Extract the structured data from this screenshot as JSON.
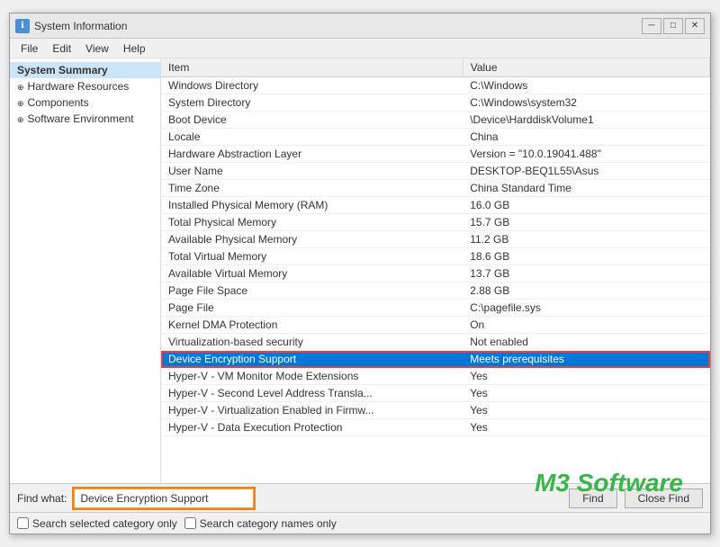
{
  "window": {
    "title": "System Information",
    "icon": "ℹ"
  },
  "menu": {
    "items": [
      "File",
      "Edit",
      "View",
      "Help"
    ]
  },
  "sidebar": {
    "items": [
      {
        "label": "System Summary",
        "level": 0,
        "bold": true,
        "selected": true,
        "expand": ""
      },
      {
        "label": "Hardware Resources",
        "level": 0,
        "bold": false,
        "selected": false,
        "expand": "⊕"
      },
      {
        "label": "Components",
        "level": 0,
        "bold": false,
        "selected": false,
        "expand": "⊕"
      },
      {
        "label": "Software Environment",
        "level": 0,
        "bold": false,
        "selected": false,
        "expand": "⊕"
      }
    ]
  },
  "table": {
    "headers": [
      "Item",
      "Value"
    ],
    "rows": [
      {
        "item": "Windows Directory",
        "value": "C:\\Windows",
        "highlighted": false
      },
      {
        "item": "System Directory",
        "value": "C:\\Windows\\system32",
        "highlighted": false
      },
      {
        "item": "Boot Device",
        "value": "\\Device\\HarddiskVolume1",
        "highlighted": false
      },
      {
        "item": "Locale",
        "value": "China",
        "highlighted": false
      },
      {
        "item": "Hardware Abstraction Layer",
        "value": "Version = \"10.0.19041.488\"",
        "highlighted": false
      },
      {
        "item": "User Name",
        "value": "DESKTOP-BEQ1L55\\Asus",
        "highlighted": false
      },
      {
        "item": "Time Zone",
        "value": "China Standard Time",
        "highlighted": false
      },
      {
        "item": "Installed Physical Memory (RAM)",
        "value": "16.0 GB",
        "highlighted": false
      },
      {
        "item": "Total Physical Memory",
        "value": "15.7 GB",
        "highlighted": false
      },
      {
        "item": "Available Physical Memory",
        "value": "11.2 GB",
        "highlighted": false
      },
      {
        "item": "Total Virtual Memory",
        "value": "18.6 GB",
        "highlighted": false
      },
      {
        "item": "Available Virtual Memory",
        "value": "13.7 GB",
        "highlighted": false
      },
      {
        "item": "Page File Space",
        "value": "2.88 GB",
        "highlighted": false
      },
      {
        "item": "Page File",
        "value": "C:\\pagefile.sys",
        "highlighted": false
      },
      {
        "item": "Kernel DMA Protection",
        "value": "On",
        "highlighted": false
      },
      {
        "item": "Virtualization-based security",
        "value": "Not enabled",
        "highlighted": false
      },
      {
        "item": "Device Encryption Support",
        "value": "Meets prerequisites",
        "highlighted": true
      },
      {
        "item": "Hyper-V - VM Monitor Mode Extensions",
        "value": "Yes",
        "highlighted": false
      },
      {
        "item": "Hyper-V - Second Level Address Transla...",
        "value": "Yes",
        "highlighted": false
      },
      {
        "item": "Hyper-V - Virtualization Enabled in Firmw...",
        "value": "Yes",
        "highlighted": false
      },
      {
        "item": "Hyper-V - Data Execution Protection",
        "value": "Yes",
        "highlighted": false
      }
    ]
  },
  "find_bar": {
    "label": "Find what:",
    "value": "Device Encryption Support",
    "find_btn": "Find",
    "close_btn": "Close Find"
  },
  "status_bar": {
    "checkbox1_label": "Search selected category only",
    "checkbox2_label": "Search category names only"
  },
  "watermark": "M3 Software",
  "title_controls": {
    "minimize": "─",
    "maximize": "□",
    "close": "✕"
  }
}
